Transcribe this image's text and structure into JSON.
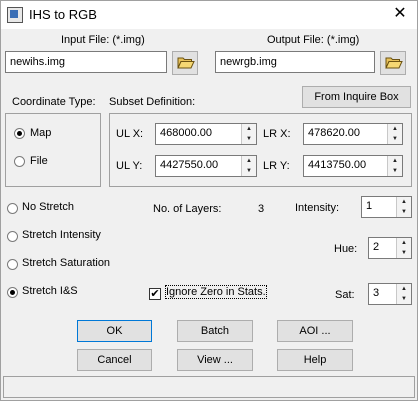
{
  "window": {
    "title": "IHS to RGB",
    "close_glyph": "✕"
  },
  "input_file": {
    "label": "Input File: (*.img)",
    "value": "newihs.img"
  },
  "output_file": {
    "label": "Output File: (*.img)",
    "value": "newrgb.img"
  },
  "coordinate_type": {
    "label": "Coordinate Type:",
    "options": [
      "Map",
      "File"
    ],
    "selected": "Map"
  },
  "subset": {
    "label": "Subset Definition:",
    "inquire_button": "From Inquire Box",
    "ul_x": {
      "label": "UL X:",
      "value": "468000.00"
    },
    "ul_y": {
      "label": "UL Y:",
      "value": "4427550.00"
    },
    "lr_x": {
      "label": "LR X:",
      "value": "478620.00"
    },
    "lr_y": {
      "label": "LR Y:",
      "value": "4413750.00"
    }
  },
  "stretch": {
    "options": [
      "No Stretch",
      "Stretch Intensity",
      "Stretch Saturation",
      "Stretch I&S"
    ],
    "selected": "Stretch I&S"
  },
  "layers": {
    "label": "No. of Layers:",
    "value": "3"
  },
  "intensity": {
    "label": "Intensity:",
    "value": "1"
  },
  "hue": {
    "label": "Hue:",
    "value": "2"
  },
  "sat": {
    "label": "Sat:",
    "value": "3"
  },
  "ignore_zero": {
    "label": "Ignore Zero in Stats.",
    "checked": true,
    "check_glyph": "✔"
  },
  "buttons": {
    "ok": "OK",
    "batch": "Batch",
    "aoi": "AOI ...",
    "cancel": "Cancel",
    "view": "View ...",
    "help": "Help"
  },
  "spin_glyphs": {
    "up": "▲",
    "down": "▼"
  },
  "colors": {
    "accent": "#0078d7",
    "window_bg": "#f0f0f0"
  },
  "icons": {
    "folder": "folder-open-icon"
  }
}
